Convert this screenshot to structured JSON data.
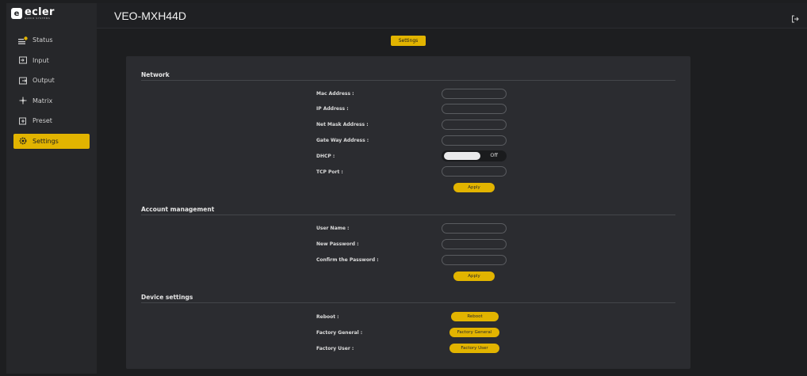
{
  "app": {
    "logo_word": "ecler",
    "logo_sub": "AUDIO SYSTEMS",
    "logo_mark": "e",
    "device_name": "VEO-MXH44D"
  },
  "sidebar": {
    "items": [
      {
        "label": "Status",
        "icon": "status-icon"
      },
      {
        "label": "Input",
        "icon": "input-icon"
      },
      {
        "label": "Output",
        "icon": "output-icon"
      },
      {
        "label": "Matrix",
        "icon": "matrix-icon"
      },
      {
        "label": "Preset",
        "icon": "preset-icon"
      },
      {
        "label": "Settings",
        "icon": "settings-gear-icon",
        "active": true
      }
    ]
  },
  "tab": {
    "label": "Settings"
  },
  "network": {
    "title": "Network",
    "mac_label": "Mac Address :",
    "mac_value": "",
    "ip_label": "IP Address :",
    "ip_value": "",
    "netmask_label": "Net Mask Address :",
    "netmask_value": "",
    "gateway_label": "Gate Way Address :",
    "gateway_value": "",
    "dhcp_label": "DHCP :",
    "dhcp_state": "Off",
    "tcp_label": "TCP Port :",
    "tcp_value": "",
    "apply_label": "Apply"
  },
  "account": {
    "title": "Account management",
    "user_label": "User Name :",
    "user_value": "",
    "newpass_label": "New Password :",
    "confirm_label": "Confirm the Password :",
    "apply_label": "Apply"
  },
  "device": {
    "title": "Device settings",
    "reboot_label": "Reboot :",
    "reboot_button": "Reboot",
    "factory_general_label": "Factory General :",
    "factory_general_button": "Factory General",
    "factory_user_label": "Factory User :",
    "factory_user_button": "Factory User"
  },
  "colors": {
    "accent": "#e2b400",
    "background": "#1d1e20",
    "panel": "#2b2c30",
    "sidebar": "#26272a"
  }
}
